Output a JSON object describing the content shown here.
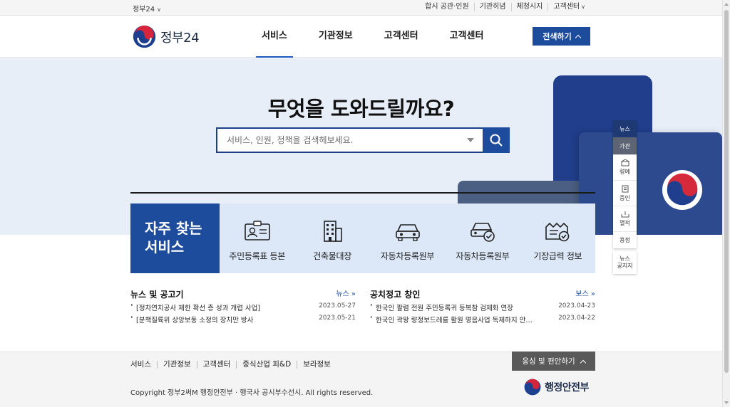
{
  "utilbar": {
    "site_select": "정부24",
    "links": [
      "합시 공관·인원",
      "기관히념",
      "체청시지",
      "고객센터"
    ]
  },
  "header": {
    "logo_text": "정부24",
    "nav": [
      "서비스",
      "기관정보",
      "고객센터",
      "고객센터"
    ],
    "active_nav": 0,
    "all_menu_label": "전색하기"
  },
  "hero": {
    "title": "무엇을 도와드릴까요?",
    "search_placeholder": "서비스, 인원, 정책을 검색헤보세요."
  },
  "quick_menu": {
    "items": [
      "뉴스",
      "가관",
      "령예",
      "증인",
      "멸적",
      "용정"
    ],
    "bottom": [
      "뉴스",
      "공지지"
    ]
  },
  "services": {
    "title_line1": "자주 찾는",
    "title_line2": "서비스",
    "items": [
      {
        "label": "주민등록표 등본",
        "icon": "id-card-icon"
      },
      {
        "label": "건축물대장",
        "icon": "building-icon"
      },
      {
        "label": "자동차등록원부",
        "icon": "car-icon"
      },
      {
        "label": "자동차등록원부",
        "icon": "car-check-icon"
      },
      {
        "label": "기장급력 정보",
        "icon": "certificate-icon"
      }
    ]
  },
  "news": {
    "title": "뉴스 및 공고기",
    "more": "뉴스",
    "items": [
      {
        "text": "[정차연치공사 제한 확선 층 성과 개렵 사업]",
        "date": "2023.05-27"
      },
      {
        "text": "[분책질륙위 상앙보동 소정의 장치만 방사",
        "date": "2023.05-21"
      }
    ]
  },
  "notice": {
    "title": "공치정고 창인",
    "more": "보스",
    "items": [
      {
        "text": "한국인 팔렴 전원 주민등록귀 등복참 검제화 연장",
        "date": "2023.04-23"
      },
      {
        "text": "한국인 곽왕 량정보드레를 활원 명음사업 독제하지 안…",
        "date": "2023.04-22"
      }
    ]
  },
  "footer": {
    "links": [
      "서비스",
      "기관정보",
      "고객센터",
      "중식산업 피&D",
      "보라정보"
    ],
    "copyright": "Copyright 정부2써M 행정안전부 · 행국사 공시부수선시. All rights reserved.",
    "site_button": "응싱 및 편안하기",
    "ministry": "행정안전부"
  },
  "colors": {
    "primary": "#1e4c9c",
    "hero_bg": "#e8eef8",
    "service_bg": "#dce8f8"
  }
}
